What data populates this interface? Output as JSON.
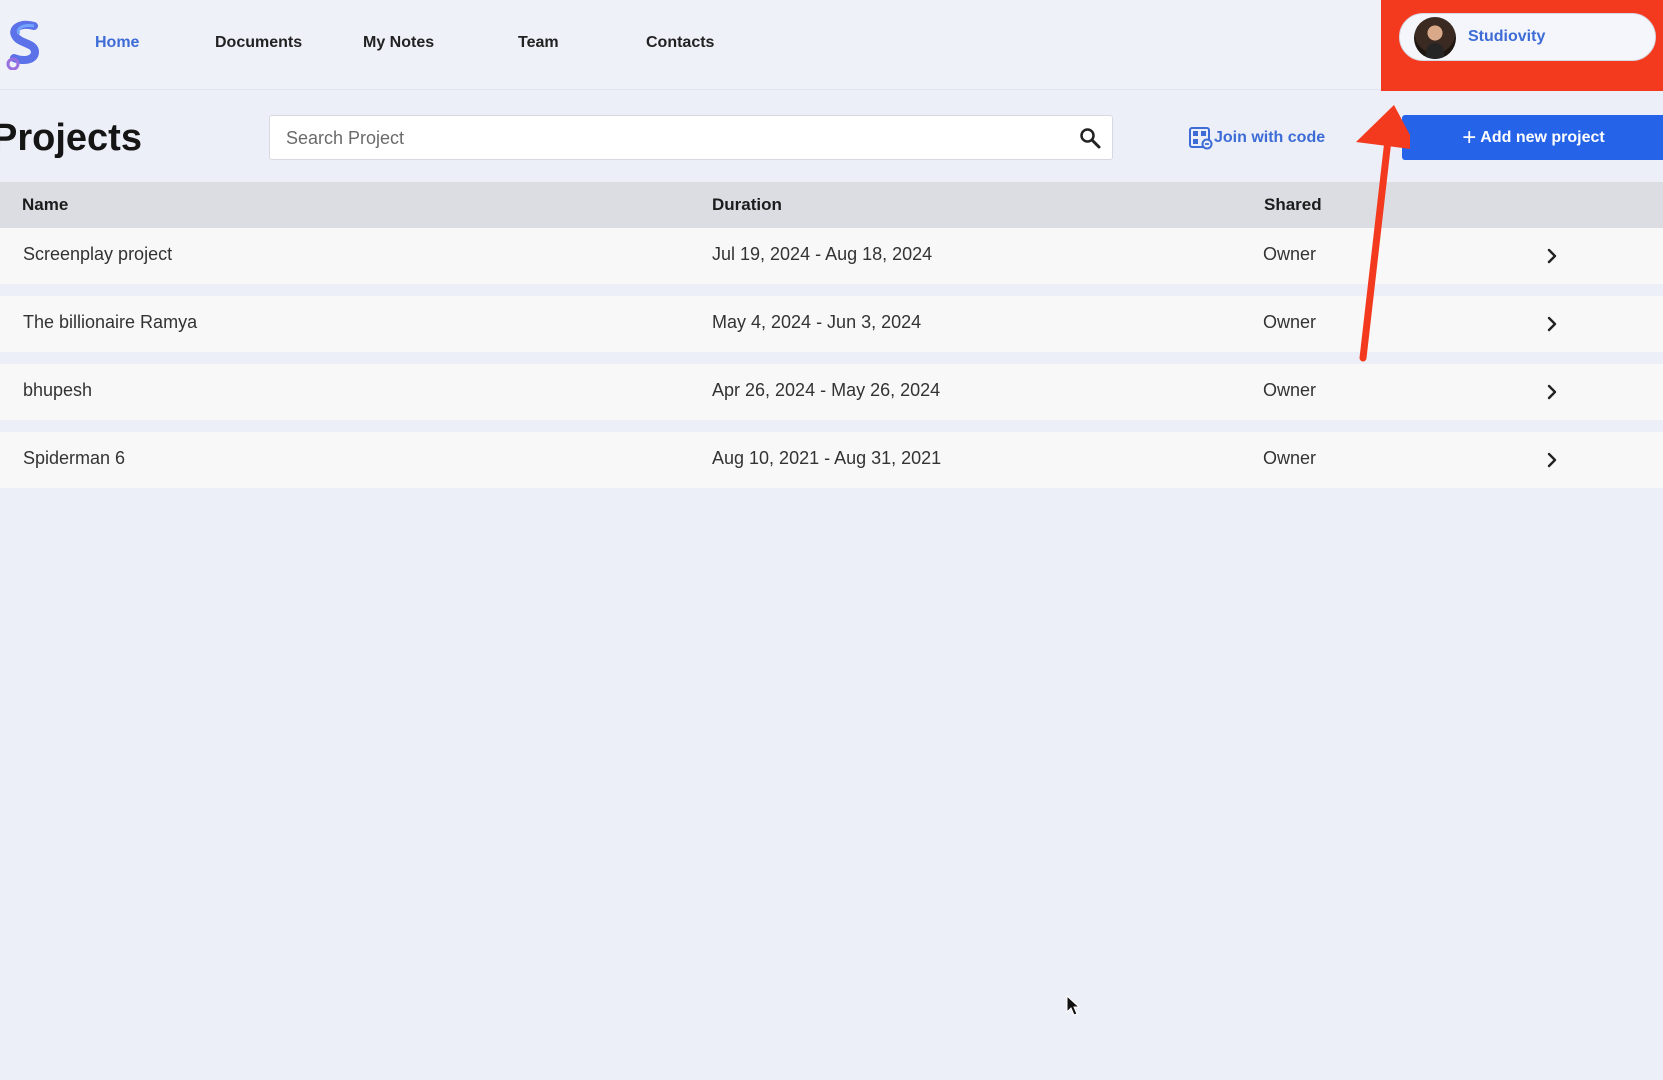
{
  "nav": {
    "logo_icon": "studiovity-s-logo-icon",
    "links": [
      "Home",
      "Documents",
      "My Notes",
      "Team",
      "Contacts"
    ],
    "active": "Home"
  },
  "profile": {
    "name": "Studiovity"
  },
  "page": {
    "title": "Projects",
    "search_placeholder": "Search Project",
    "join_label": "Join with code",
    "add_label": "Add new project"
  },
  "table": {
    "headers": [
      "Name",
      "Duration",
      "Shared"
    ],
    "rows": [
      {
        "name": "Screenplay project",
        "duration": "Jul 19, 2024 - Aug 18, 2024",
        "shared": "Owner"
      },
      {
        "name": "The billionaire Ramya",
        "duration": "May 4, 2024 - Jun 3, 2024",
        "shared": "Owner"
      },
      {
        "name": "bhupesh",
        "duration": "Apr 26, 2024 - May 26, 2024",
        "shared": "Owner"
      },
      {
        "name": "Spiderman 6",
        "duration": "Aug 10, 2021 - Aug 31, 2021",
        "shared": "Owner"
      }
    ]
  },
  "colors": {
    "accent": "#3d6cd6",
    "primary_button": "#2563e8",
    "annotation": "#f33a1f"
  }
}
